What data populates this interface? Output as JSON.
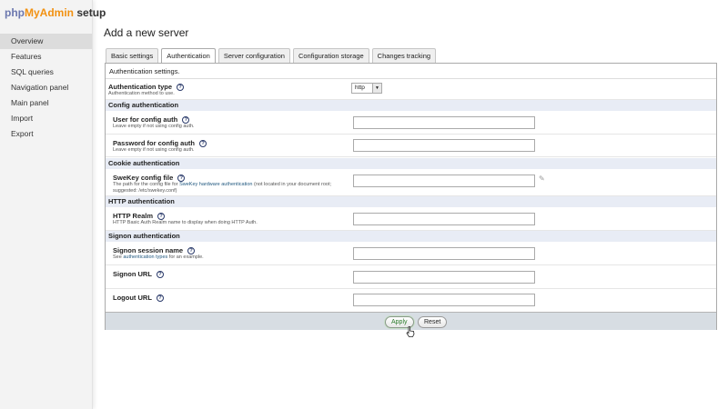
{
  "logo": {
    "part1": "php",
    "part2": "MyAdmin",
    "part3": "setup"
  },
  "nav": [
    {
      "label": "Overview",
      "active": true
    },
    {
      "label": "Features"
    },
    {
      "label": "SQL queries"
    },
    {
      "label": "Navigation panel"
    },
    {
      "label": "Main panel"
    },
    {
      "label": "Import"
    },
    {
      "label": "Export"
    }
  ],
  "page": {
    "title": "Add a new server"
  },
  "tabs": [
    {
      "label": "Basic settings"
    },
    {
      "label": "Authentication",
      "active": true
    },
    {
      "label": "Server configuration"
    },
    {
      "label": "Configuration storage"
    },
    {
      "label": "Changes tracking"
    }
  ],
  "form": {
    "description": "Authentication settings.",
    "auth_type": {
      "label": "Authentication type",
      "desc": "Authentication method to use.",
      "value": "http"
    },
    "sections": {
      "config": "Config authentication",
      "cookie": "Cookie authentication",
      "http": "HTTP authentication",
      "signon": "Signon authentication"
    },
    "fields": {
      "user": {
        "label": "User for config auth",
        "desc": "Leave empty if not using config auth."
      },
      "password": {
        "label": "Password for config auth",
        "desc": "Leave empty if not using config auth."
      },
      "swekey": {
        "label": "SweKey config file",
        "desc_pre": "The path for the config file for ",
        "desc_link": "SweKey hardware authentication",
        "desc_post": " (not located in your document root; suggested: /etc/swekey.conf)"
      },
      "realm": {
        "label": "HTTP Realm",
        "desc": "HTTP Basic Auth Realm name to display when doing HTTP Auth."
      },
      "signon_session": {
        "label": "Signon session name",
        "desc_pre": "See ",
        "desc_link": "authentication types",
        "desc_post": " for an example."
      },
      "signon_url": {
        "label": "Signon URL"
      },
      "logout_url": {
        "label": "Logout URL"
      }
    },
    "help_glyph": "?"
  },
  "actions": {
    "apply": "Apply",
    "reset": "Reset"
  },
  "icons": {
    "select_arrow": "▼",
    "pencil": "✎"
  },
  "colors": {
    "brand_php": "#6c78af",
    "brand_mysql": "#f29111",
    "section_bg": "#e8ecf5",
    "apply_text": "#2a7a2a"
  }
}
